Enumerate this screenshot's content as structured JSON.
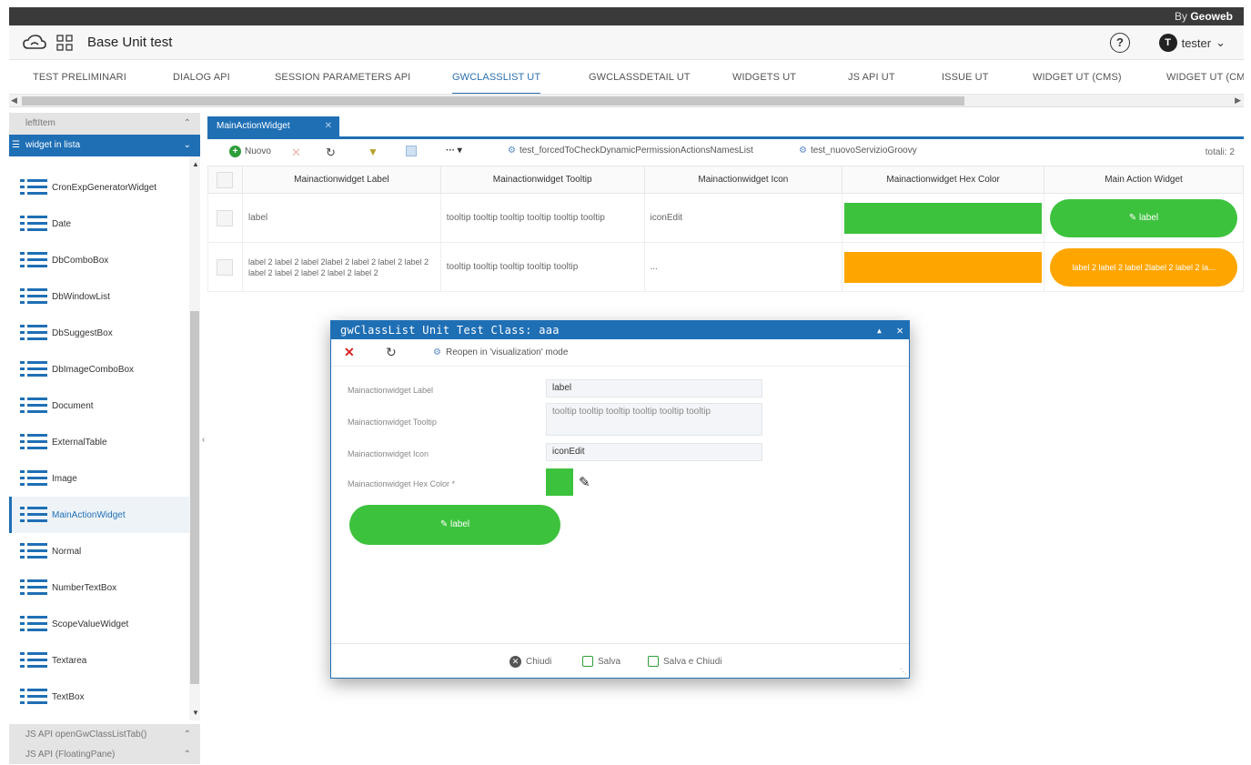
{
  "app": {
    "brand_prefix": "By",
    "brand_name": "Geoweb",
    "title": "Base Unit test",
    "help_label": "?",
    "user_initial": "T",
    "user_name": "tester"
  },
  "main_tabs": [
    {
      "label": "TEST PRELIMINARI"
    },
    {
      "label": "DIALOG API"
    },
    {
      "label": "SESSION PARAMETERS API"
    },
    {
      "label": "GWCLASSLIST UT"
    },
    {
      "label": "GWCLASSDETAIL UT"
    },
    {
      "label": "WIDGETS UT"
    },
    {
      "label": "JS API UT"
    },
    {
      "label": "ISSUE UT"
    },
    {
      "label": "WIDGET UT (CMS)"
    },
    {
      "label": "WIDGET UT (CM"
    }
  ],
  "sidebar": {
    "header_top": "leftItem",
    "header_active": "widget in lista",
    "items": [
      {
        "label": "CronExpGeneratorWidget"
      },
      {
        "label": "Date"
      },
      {
        "label": "DbComboBox"
      },
      {
        "label": "DbWindowList"
      },
      {
        "label": "DbSuggestBox"
      },
      {
        "label": "DbImageComboBox"
      },
      {
        "label": "Document"
      },
      {
        "label": "ExternalTable"
      },
      {
        "label": "Image"
      },
      {
        "label": "MainActionWidget"
      },
      {
        "label": "Normal"
      },
      {
        "label": "NumberTextBox"
      },
      {
        "label": "ScopeValueWidget"
      },
      {
        "label": "Textarea"
      },
      {
        "label": "TextBox"
      }
    ],
    "footer_items": [
      {
        "label": "JS API openGwClassListTab()"
      },
      {
        "label": "JS API (FloatingPane)"
      }
    ]
  },
  "subtab": {
    "label": "MainActionWidget"
  },
  "toolbar": {
    "new_label": "Nuovo",
    "action1": "test_forcedToCheckDynamicPermissionActionsNamesList",
    "action2": "test_nuovoServizioGroovy",
    "total": "totali: 2"
  },
  "grid": {
    "columns": [
      "Mainactionwidget Label",
      "Mainactionwidget Tooltip",
      "Mainactionwidget Icon",
      "Mainactionwidget Hex Color",
      "Main Action Widget"
    ],
    "rows": [
      {
        "label": "label",
        "tooltip": "tooltip tooltip tooltip tooltip tooltip tooltip",
        "icon": "iconEdit",
        "color": "#3dc23d",
        "widget_text": "label",
        "widget_color": "#3dc23d"
      },
      {
        "label": "label 2 label 2 label 2label 2 label 2 label 2 label 2 label 2 label 2 label 2 label 2 label 2",
        "tooltip": "tooltip tooltip tooltip tooltip tooltip",
        "icon": "...",
        "color": "#ffa500",
        "widget_text": "label 2 label 2 label 2label 2 label 2 la...",
        "widget_color": "#ffa500"
      }
    ]
  },
  "modal": {
    "title": "gwClassList Unit Test Class: aaa",
    "reopen_label": "Reopen in 'visualization' mode",
    "fields": {
      "label_caption": "Mainactionwidget Label",
      "label_value": "label",
      "tooltip_caption": "Mainactionwidget Tooltip",
      "tooltip_value": "tooltip tooltip tooltip tooltip tooltip tooltip",
      "icon_caption": "Mainactionwidget Icon",
      "icon_value": "iconEdit",
      "color_caption": "Mainactionwidget Hex Color *",
      "color_value": "#3dc23d"
    },
    "button_label": "label",
    "footer": {
      "close": "Chiudi",
      "save": "Salva",
      "save_close": "Salva e Chiudi"
    }
  },
  "colors": {
    "accent": "#1f6fb5",
    "green": "#3dc23d",
    "orange": "#ffa500"
  }
}
